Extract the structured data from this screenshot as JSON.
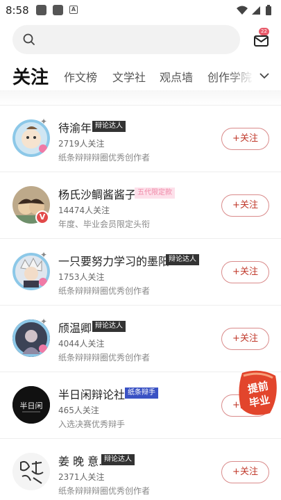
{
  "status_bar": {
    "time": "8:58",
    "app_icon_letter": "A"
  },
  "search": {
    "placeholder": ""
  },
  "mail": {
    "badge": "22"
  },
  "tabs": [
    {
      "label": "关注"
    },
    {
      "label": "作文榜"
    },
    {
      "label": "文学社"
    },
    {
      "label": "观点墙"
    },
    {
      "label": "创作学院"
    }
  ],
  "users": [
    {
      "name": "待渝年",
      "badge": "辩论达人",
      "badge_style": "dark",
      "followers": "2719人关注",
      "desc": "纸条辩辩辩圈优秀创作者",
      "follow": "+关注"
    },
    {
      "name": "杨氏沙鲷酱酱子",
      "badge": "五代限定款",
      "badge_style": "pink",
      "followers": "14474人关注",
      "desc": "年度、毕业会员限定头衔",
      "follow": "+关注"
    },
    {
      "name": "一只要努力学习的墨阳",
      "badge": "辩论达人",
      "badge_style": "dark",
      "followers": "1753人关注",
      "desc": "纸条辩辩辩圈优秀创作者",
      "follow": "+关注"
    },
    {
      "name": "颀温卿",
      "badge": "辩论达人",
      "badge_style": "dark",
      "followers": "4044人关注",
      "desc": "纸条辩辩辩圈优秀创作者",
      "follow": "+关注"
    },
    {
      "name": "半日闲辩论社",
      "badge": "纸条辩手",
      "badge_style": "blue",
      "followers": "465人关注",
      "desc": "入选决赛优秀辩手",
      "follow": "+关注"
    },
    {
      "name": "姜 晚 意.",
      "badge": "辩论达人",
      "badge_style": "dark",
      "followers": "2371人关注",
      "desc": "纸条辩辩辩圈优秀创作者",
      "follow": "+关注"
    }
  ],
  "verified_mark": "V",
  "avatar_text_row5": "半日闲",
  "sticker": {
    "line1": "提前",
    "line2": "毕业"
  },
  "colors": {
    "accent": "#c0392b",
    "badge_dark": "#333333",
    "badge_blue": "#3a52c4",
    "mail_badge": "#e85a6a"
  }
}
